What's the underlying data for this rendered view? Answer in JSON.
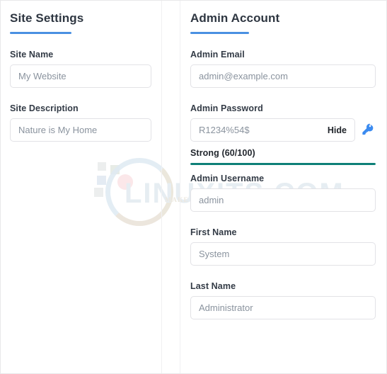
{
  "watermark": {
    "text": "LINUXITS.COM",
    "tagline": "MAKE EASY YOUR SYSADMIN LIFE"
  },
  "colors": {
    "accent_blue": "#4a90e2",
    "strength_teal": "#0e8078",
    "key_icon_blue": "#3b8bf0",
    "label_text": "#333b46",
    "input_text": "#8a939e",
    "border": "#e2e2e6"
  },
  "left_panel": {
    "title": "Site Settings",
    "fields": [
      {
        "label": "Site Name",
        "value": "My Website",
        "placeholder": "My Website"
      },
      {
        "label": "Site Description",
        "value": "Nature is My Home",
        "placeholder": "Nature is My Home"
      }
    ]
  },
  "right_panel": {
    "title": "Admin Account",
    "email": {
      "label": "Admin Email",
      "value": "admin@example.com",
      "placeholder": "admin@example.com"
    },
    "password": {
      "label": "Admin Password",
      "value": "R1234%54$",
      "placeholder": "R1234%54$",
      "toggle_label": "Hide",
      "generate_icon": "key-icon"
    },
    "strength": {
      "label": "Strong (60/100)",
      "level": "Strong",
      "score": 60,
      "max": 100,
      "percent": "100%"
    },
    "fields": [
      {
        "label": "Admin Username",
        "value": "admin",
        "placeholder": "admin"
      },
      {
        "label": "First Name",
        "value": "System",
        "placeholder": "System"
      },
      {
        "label": "Last Name",
        "value": "Administrator",
        "placeholder": "Administrator"
      }
    ]
  }
}
